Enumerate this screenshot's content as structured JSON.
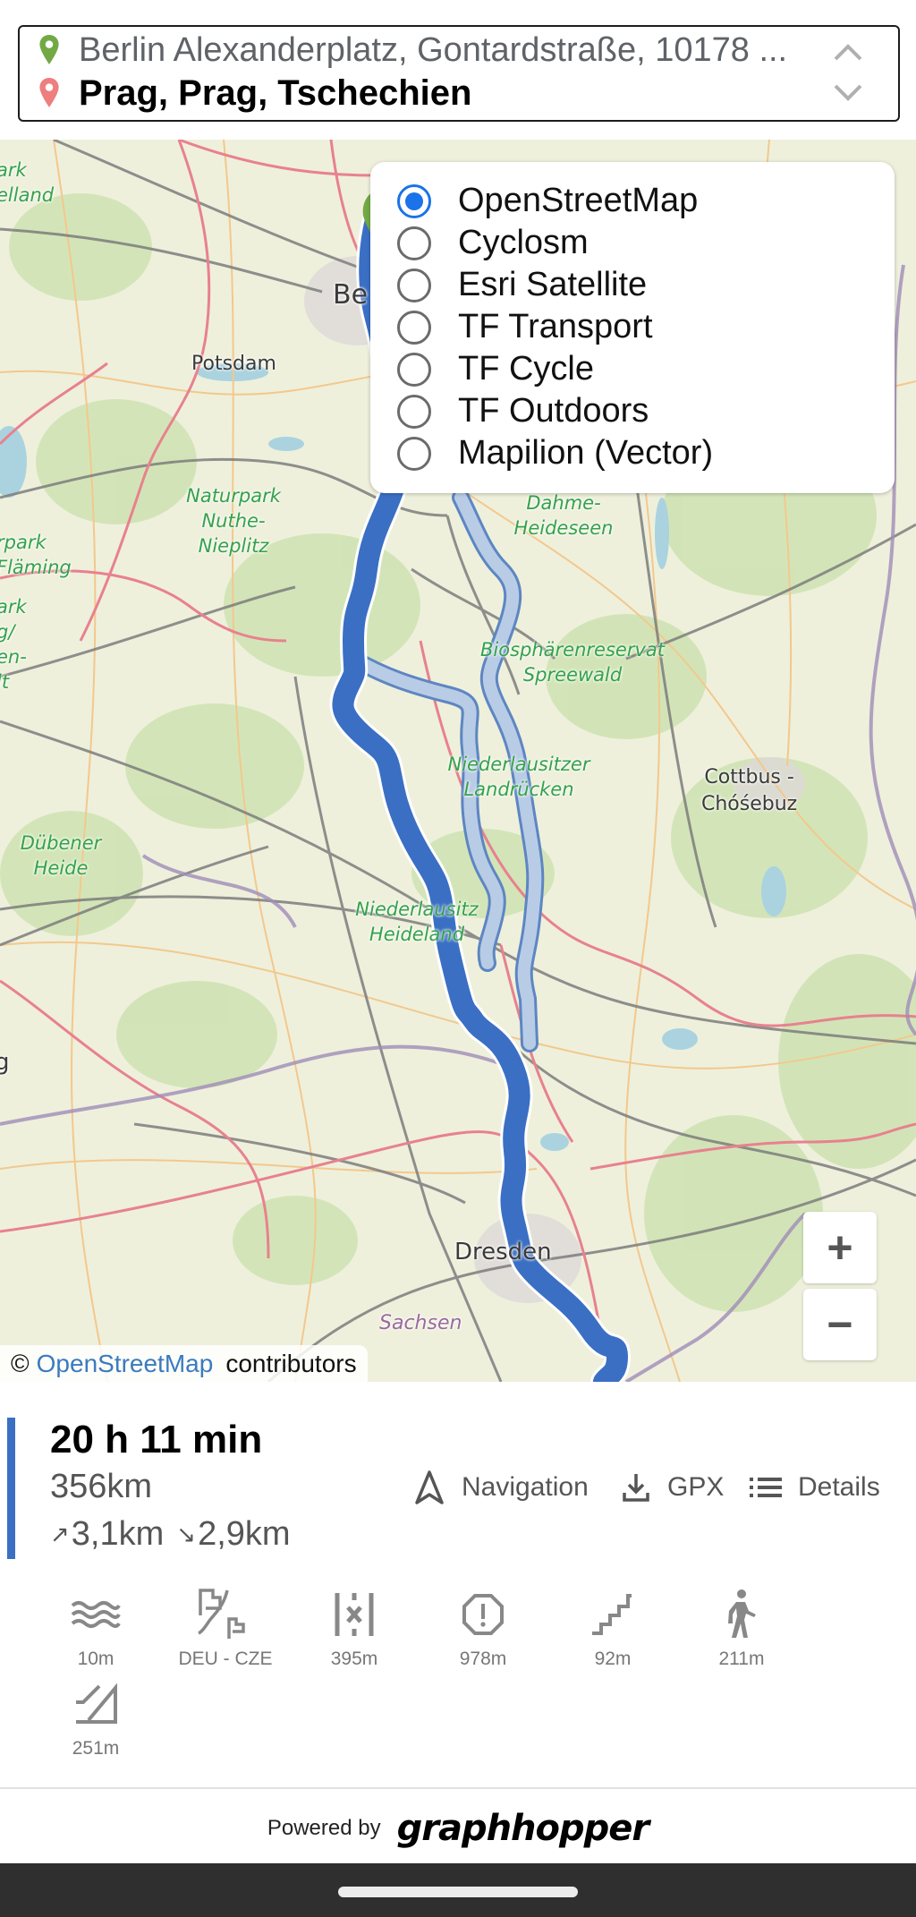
{
  "search": {
    "from": "Berlin Alexanderplatz, Gontardstraße, 10178 ...",
    "to": "Prag, Prag, Tschechien",
    "from_pin_color": "#72a944",
    "to_pin_color": "#ef7e7e",
    "move_up_icon": "chevron-up-icon",
    "move_down_icon": "chevron-down-icon"
  },
  "map": {
    "labels": {
      "havelland": "ark\nelland",
      "potsdam": "Potsdam",
      "berlin": "Be",
      "nuthe": "Naturpark\nNuthe-\nNieplitz",
      "flaeming_left": "rpark\nFläming",
      "fläming_lower": "ark\ng/\nen-\nlt",
      "dahme": "Dahme-\nHeideseen",
      "spreewald": "Biosphärenreservat\nSpreewald",
      "landruecken": "Niederlausitzer\nLandrücken",
      "cottbus": "Cottbus -\nChóśebuz",
      "duebener": "Dübener\nHeide",
      "niederlausitz": "Niederlausitz\nHeideland",
      "dresden": "Dresden",
      "sachsen": "Sachsen",
      "edge_g": "g"
    },
    "route_color": "#3a6fc4",
    "alt_route_color": "#a9c2e3",
    "layers": [
      {
        "label": "OpenStreetMap",
        "selected": true
      },
      {
        "label": "Cyclosm",
        "selected": false
      },
      {
        "label": "Esri Satellite",
        "selected": false
      },
      {
        "label": "TF Transport",
        "selected": false
      },
      {
        "label": "TF Cycle",
        "selected": false
      },
      {
        "label": "TF Outdoors",
        "selected": false
      },
      {
        "label": "Mapilion (Vector)",
        "selected": false
      }
    ],
    "zoom_in": "+",
    "zoom_out": "−",
    "attribution": {
      "prefix": "©",
      "link": "OpenStreetMap",
      "suffix": "contributors"
    }
  },
  "route": {
    "duration": "20 h 11 min",
    "distance": "356km",
    "ascend": "3,1km",
    "descend": "2,9km",
    "ascend_icon": "↗",
    "descend_icon": "↘",
    "actions": {
      "navigation": "Navigation",
      "gpx": "GPX",
      "details": "Details"
    },
    "details": [
      {
        "icon": "waves-icon",
        "value": "10m"
      },
      {
        "icon": "border-crossing-icon",
        "value": "DEU - CZE"
      },
      {
        "icon": "road-restriction-icon",
        "value": "395m"
      },
      {
        "icon": "warning-octagon-icon",
        "value": "978m"
      },
      {
        "icon": "stairs-icon",
        "value": "92m"
      },
      {
        "icon": "pedestrian-icon",
        "value": "211m"
      },
      {
        "icon": "steep-incline-icon",
        "value": "251m"
      }
    ]
  },
  "footer": {
    "powered_by": "Powered by",
    "brand": "graphhopper"
  }
}
